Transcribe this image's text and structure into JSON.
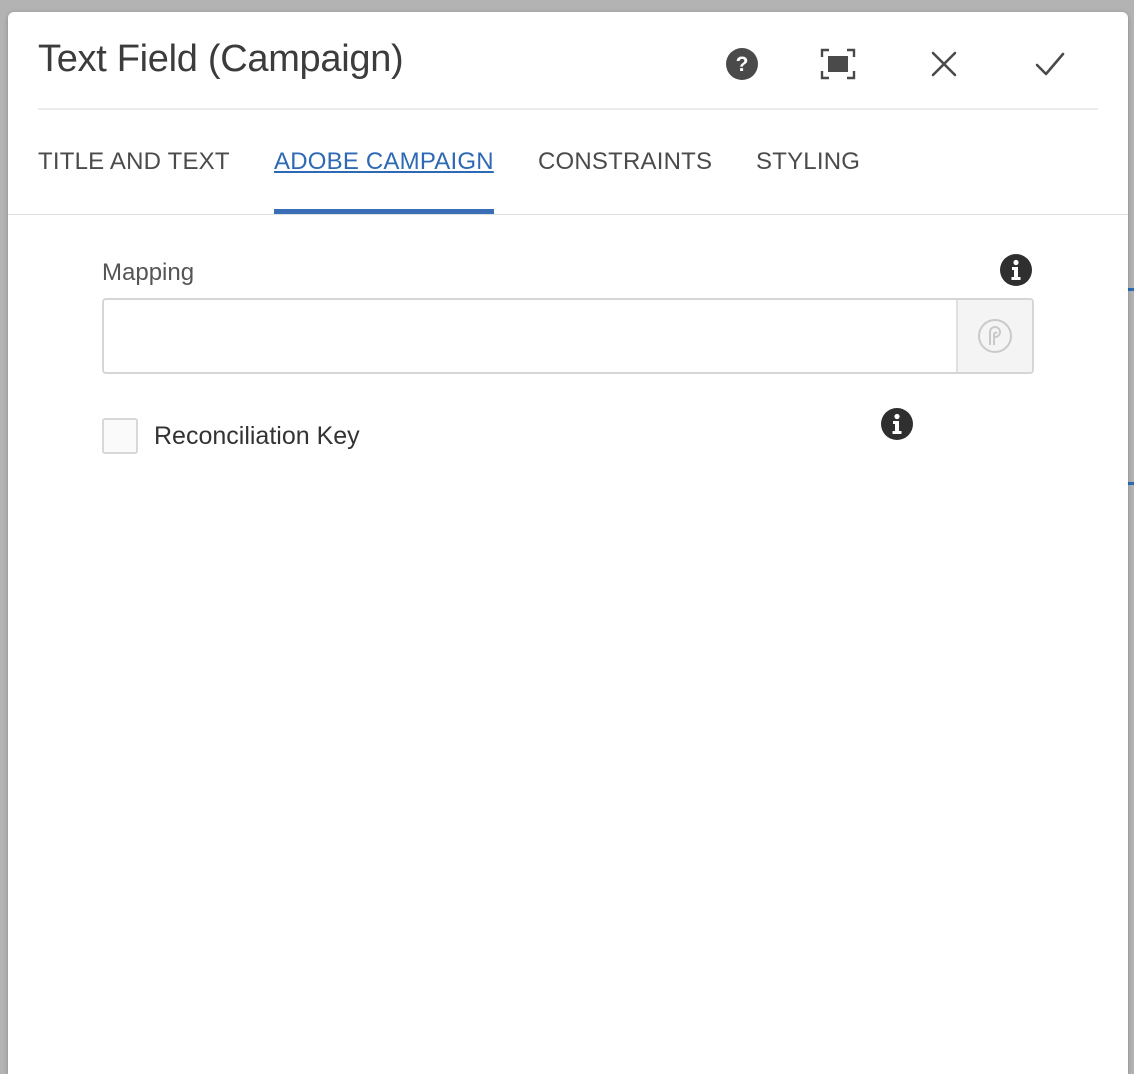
{
  "dialog": {
    "title": "Text Field (Campaign)",
    "actions": {
      "help": "help-icon",
      "fullscreen": "fullscreen-icon",
      "close": "close-icon",
      "done": "checkmark-icon"
    }
  },
  "tabs": [
    {
      "label": "TITLE AND TEXT",
      "active": false
    },
    {
      "label": "ADOBE CAMPAIGN",
      "active": true
    },
    {
      "label": "CONSTRAINTS",
      "active": false
    },
    {
      "label": "STYLING",
      "active": false
    }
  ],
  "form": {
    "mapping": {
      "label": "Mapping",
      "value": "",
      "picker_icon": "field-picker-icon"
    },
    "reconciliation_key": {
      "label": "Reconciliation Key",
      "checked": false
    }
  },
  "colors": {
    "accent": "#2d69b4",
    "title_text": "#3c3c3c",
    "icon_dark": "#2f2f2f"
  }
}
